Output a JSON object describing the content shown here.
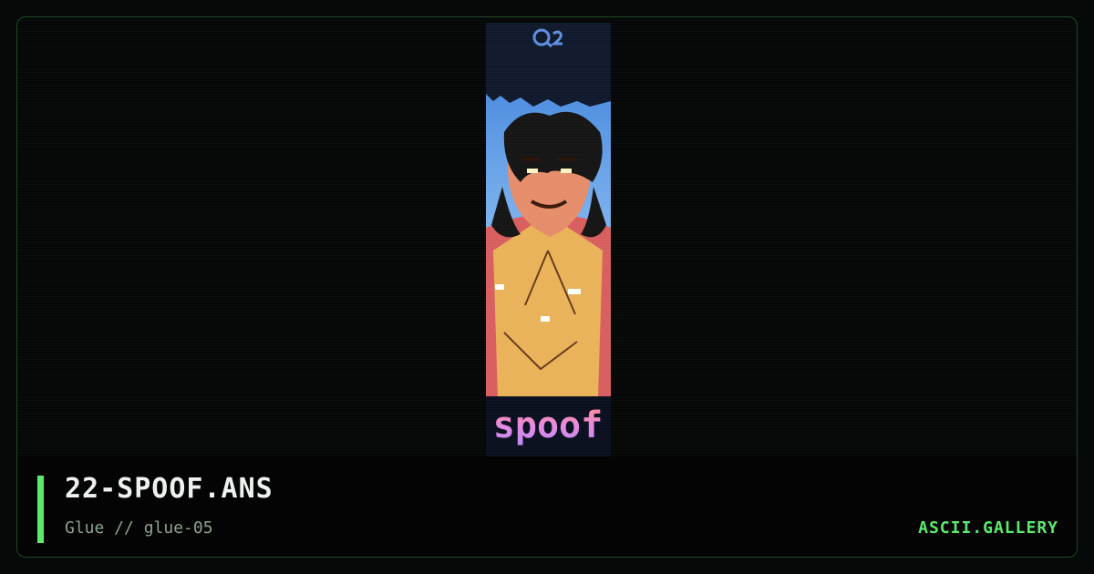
{
  "art": {
    "logo_text": "Q2",
    "caption_text": "spoof"
  },
  "footer": {
    "title": "22-SPOOF.ANS",
    "subtitle": "Glue // glue-05",
    "brand": "ASCII.GALLERY"
  },
  "colors": {
    "accent": "#5bea6c",
    "border": "#1e4a22",
    "background": "#050a08"
  }
}
